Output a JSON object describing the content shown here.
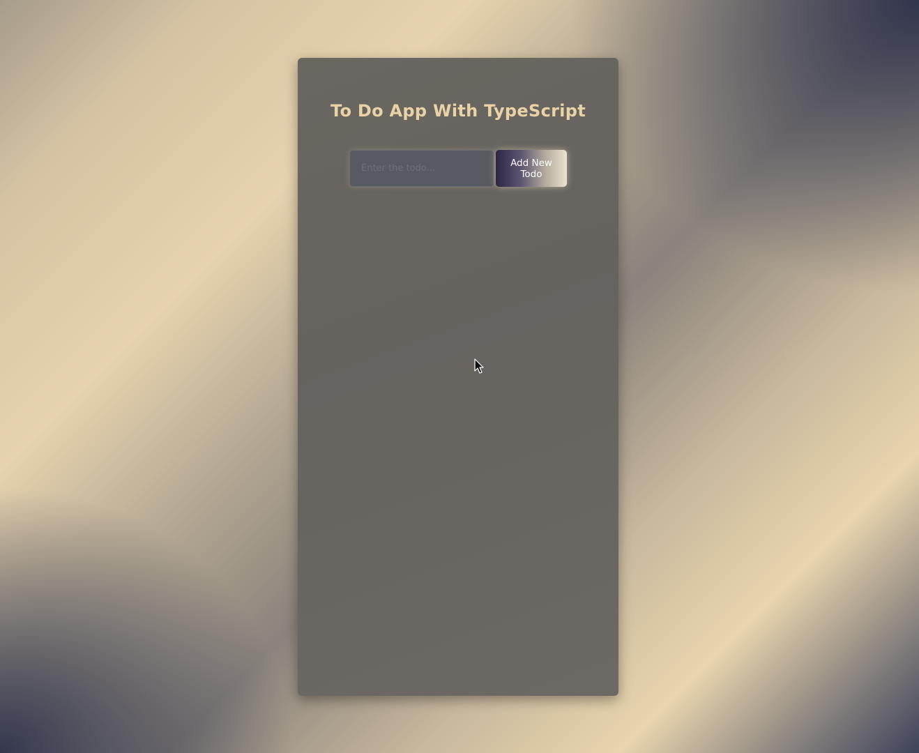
{
  "app": {
    "title": "To Do App With TypeScript"
  },
  "form": {
    "input_placeholder": "Enter the todo...",
    "input_value": "",
    "add_button_label": "Add New Todo"
  },
  "todos": [],
  "colors": {
    "title": "#e9d2a6",
    "card": "#686560",
    "button_gradient_start": "#2c2644",
    "button_gradient_end": "#ece3cf"
  },
  "icons": {
    "cursor": "mouse-pointer-icon"
  }
}
